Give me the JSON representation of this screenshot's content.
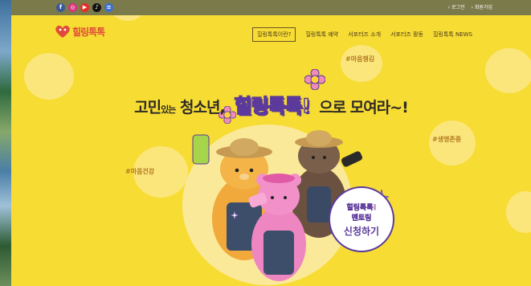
{
  "topbar": {
    "social_icons": [
      "facebook-icon",
      "instagram-icon",
      "youtube-icon",
      "tiktok-icon",
      "kakao-icon"
    ],
    "social_glyphs": [
      "f",
      "◎",
      "▶",
      "♪",
      "≡"
    ],
    "social_colors": [
      "#3b5998",
      "#d9317a",
      "#e52d27",
      "#111111",
      "#3c6fd1"
    ],
    "login": "› 로그인",
    "signup": "› 회원가입"
  },
  "logo": {
    "text": "힐링톡톡"
  },
  "nav": {
    "items": [
      "힐링톡톡이란?",
      "힐링톡톡 예약",
      "서포터즈 소개",
      "서포터즈 활동",
      "힐링톡톡 NEWS"
    ]
  },
  "hashtags": {
    "mind_care": "#마음챙김",
    "respect_life": "#생명존중",
    "mind_health": "#마음건강"
  },
  "headline": {
    "part1": "고민",
    "part1_small": "있는",
    "part2": "청소년,",
    "brand": "힐링톡톡!",
    "part3": "으로 모여라~!"
  },
  "badge": {
    "line1": "힐링톡톡!",
    "line2": "멘토링",
    "line3": "신청하기"
  },
  "colors": {
    "background": "#f7dc33",
    "accent_purple": "#5b3a9b",
    "logo_red": "#e04a3a"
  }
}
